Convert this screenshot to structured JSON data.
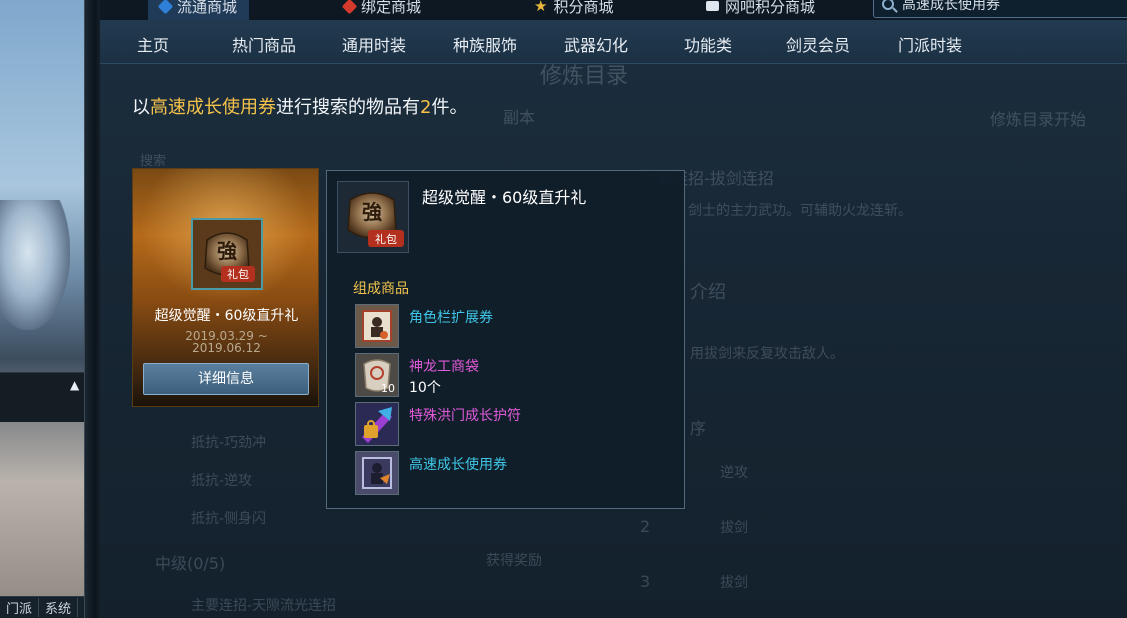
{
  "scene": {
    "bottom_tabs": [
      "门派",
      "系统"
    ]
  },
  "top_tabs": [
    {
      "label": "流通商城",
      "active": true,
      "icon": "blue-diamond-icon"
    },
    {
      "label": "绑定商城",
      "active": false,
      "icon": "red-gem-icon"
    },
    {
      "label": "积分商城",
      "active": false,
      "icon": "gold-star-icon"
    },
    {
      "label": "网吧积分商城",
      "active": false,
      "icon": "pc-monitor-icon"
    }
  ],
  "search": {
    "value": "高速成长使用券",
    "icon": "search-icon"
  },
  "categories": [
    "主页",
    "热门商品",
    "通用时装",
    "种族服饰",
    "武器幻化",
    "功能类",
    "剑灵会员",
    "门派时装"
  ],
  "result": {
    "prefix": "以",
    "keyword": "高速成长使用券",
    "middle": "进行搜索的物品有",
    "count": "2",
    "suffix": "件。"
  },
  "card": {
    "name": "超级觉醒・60级直升礼",
    "date_start": "2019.03.29 ~",
    "date_end": "2019.06.12",
    "detail_button": "详细信息",
    "icon": "gift-box-icon",
    "icon_text_1": "強",
    "icon_text_2": "礼包"
  },
  "tooltip": {
    "title": "超级觉醒・60级直升礼",
    "section_label": "组成商品",
    "icon_text_1": "強",
    "icon_text_2": "礼包",
    "items": [
      {
        "label": "角色栏扩展券",
        "color": "#3fc6e6",
        "icon": "character-slot-ticket-icon",
        "qty": "",
        "stack": ""
      },
      {
        "label": "神龙工商袋",
        "color": "#e05ad9",
        "icon": "merchant-bag-icon",
        "qty": "10个",
        "stack": "10"
      },
      {
        "label": "特殊洪门成长护符",
        "color": "#e05ad9",
        "icon": "growth-charm-icon",
        "qty": "",
        "stack": ""
      },
      {
        "label": "高速成长使用券",
        "color": "#3fc6e6",
        "icon": "growth-ticket-icon",
        "qty": "",
        "stack": ""
      }
    ]
  },
  "background_text": {
    "title": "修炼目录",
    "tab": "副本",
    "start": "修炼目录开始",
    "search_hint": "搜索",
    "combo_title": "主要连招-拔剑连招",
    "combo_desc": "剑士的主力武功。可辅助火龙连斩。",
    "intro": "介绍",
    "skill_desc": "用拔剑来反复攻击敌人。",
    "order": "序",
    "list": [
      "抵抗-巧劲冲",
      "抵抗-逆攻",
      "抵抗-侧身闪",
      "中级(0/5)",
      "主要连招-天隙流光连招"
    ],
    "get_reward": "获得奖励",
    "step_labels": [
      "逆攻",
      "拔剑",
      "拔剑"
    ],
    "step_numbers": [
      "2",
      "3"
    ]
  }
}
